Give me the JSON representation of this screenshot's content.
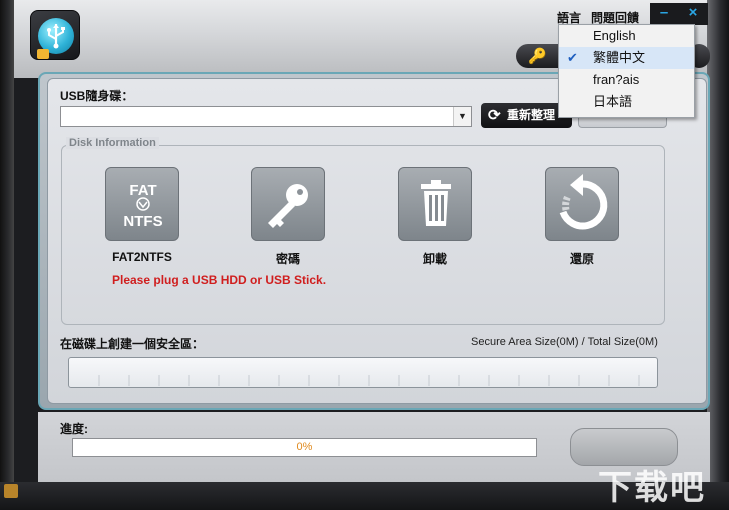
{
  "window": {
    "menu_language": "語言",
    "menu_feedback": "問題回饋",
    "minimize_glyph": "–",
    "close_glyph": "×"
  },
  "language_menu": {
    "items": [
      {
        "label": "English",
        "checked": false
      },
      {
        "label": "繁體中文",
        "checked": true
      },
      {
        "label": "fran?ais",
        "checked": false
      },
      {
        "label": "日本語",
        "checked": false
      }
    ],
    "check_glyph": "✔"
  },
  "usb": {
    "label": "USB隨身碟：",
    "selected_value": "",
    "refresh_label": "重新整理"
  },
  "disk_info": {
    "legend": "Disk Information",
    "tools": [
      {
        "name": "fat2ntfs",
        "label": "FAT2NTFS",
        "icon": "fat-ntfs-icon",
        "icon_text_top": "FAT",
        "icon_text_bottom": "NTFS"
      },
      {
        "name": "password",
        "label": "密碼",
        "icon": "key-icon"
      },
      {
        "name": "uninstall",
        "label": "卸載",
        "icon": "trash-icon"
      },
      {
        "name": "restore",
        "label": "還原",
        "icon": "restore-icon"
      }
    ],
    "warning": "Please plug a USB HDD or USB Stick."
  },
  "secure_area": {
    "label": "在磁碟上創建一個安全區：",
    "size_info": "Secure Area Size(0M) / Total Size(0M)"
  },
  "progress": {
    "label": "進度:",
    "percent_text": "0%",
    "value": 0
  },
  "watermark": "下载吧",
  "colors": {
    "accent": "#2aa7e6",
    "warning": "#d01e1e",
    "progress_text": "#e08a1e"
  }
}
